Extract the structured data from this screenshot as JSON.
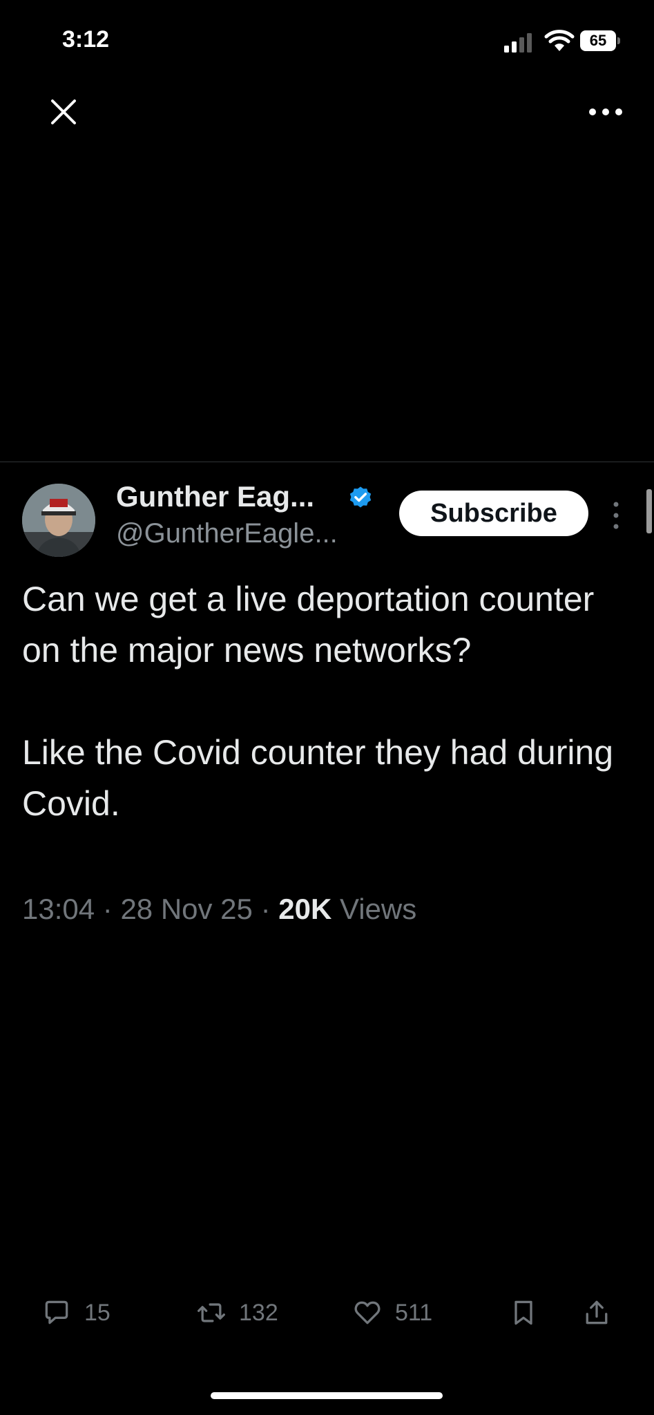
{
  "status_bar": {
    "time": "3:12",
    "battery": "65",
    "icons": [
      "signal-icon",
      "wifi-icon",
      "battery-icon"
    ]
  },
  "top_bar": {
    "close_icon": "close-icon",
    "more_icon": "more-horizontal-icon"
  },
  "tweet": {
    "author_name": "Gunther Eag...",
    "author_handle": "@GuntherEagle...",
    "verified": true,
    "subscribe_label": "Subscribe",
    "text": "Can we get a live deportation counter on the major news networks?\n\nLike the Covid counter they had during Covid.",
    "time": "13:04",
    "separator": " · ",
    "date": "28 Nov 25",
    "views_count": "20K",
    "views_label": " Views"
  },
  "actions": {
    "replies": "15",
    "retweets": "132",
    "likes": "511"
  },
  "colors": {
    "background": "#000000",
    "text": "#e7e9ea",
    "muted": "#71767b",
    "verified": "#1d9bf0"
  }
}
